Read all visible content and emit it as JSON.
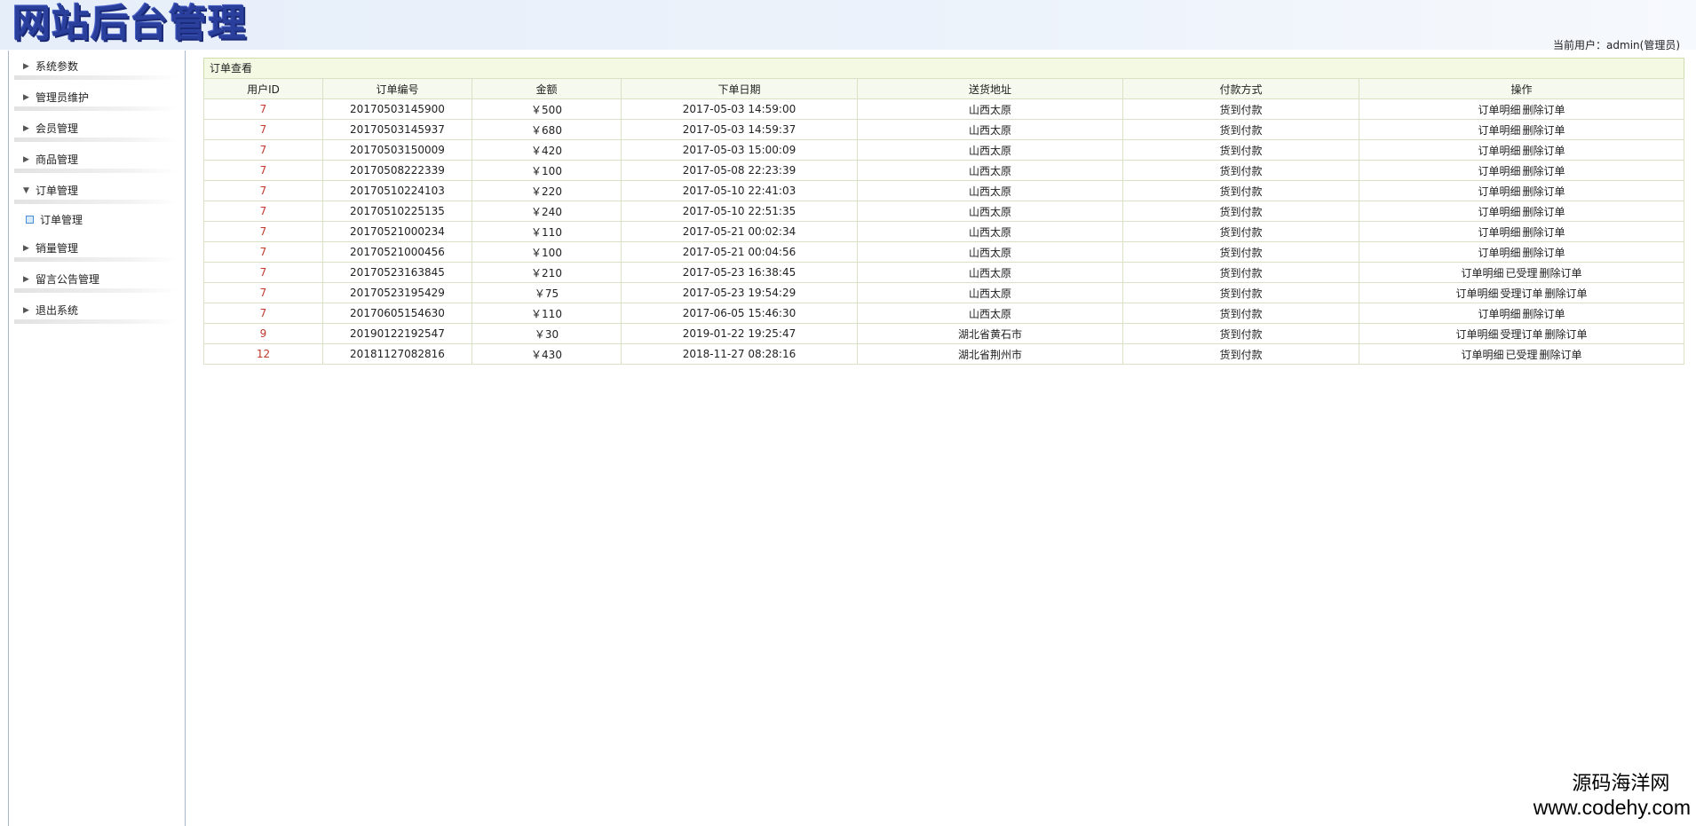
{
  "header": {
    "logo_text": "网站后台管理",
    "current_user": "当前用户：admin(管理员)"
  },
  "sidebar": {
    "items": [
      {
        "label": "系统参数",
        "expanded": false
      },
      {
        "label": "管理员维护",
        "expanded": false
      },
      {
        "label": "会员管理",
        "expanded": false
      },
      {
        "label": "商品管理",
        "expanded": false
      },
      {
        "label": "订单管理",
        "expanded": true,
        "children": [
          {
            "label": "订单管理"
          }
        ]
      },
      {
        "label": "销量管理",
        "expanded": false
      },
      {
        "label": "留言公告管理",
        "expanded": false
      },
      {
        "label": "退出系统",
        "expanded": false
      }
    ]
  },
  "panel": {
    "title": "订单查看",
    "columns": [
      "用户ID",
      "订单编号",
      "金额",
      "下单日期",
      "送货地址",
      "付款方式",
      "操作"
    ],
    "rows": [
      {
        "user_id": "7",
        "order_no": "20170503145900",
        "amount": "￥500",
        "date": "2017-05-03 14:59:00",
        "address": "山西太原",
        "payment": "货到付款",
        "ops": [
          "订单明细",
          "删除订单"
        ]
      },
      {
        "user_id": "7",
        "order_no": "20170503145937",
        "amount": "￥680",
        "date": "2017-05-03 14:59:37",
        "address": "山西太原",
        "payment": "货到付款",
        "ops": [
          "订单明细",
          "删除订单"
        ]
      },
      {
        "user_id": "7",
        "order_no": "20170503150009",
        "amount": "￥420",
        "date": "2017-05-03 15:00:09",
        "address": "山西太原",
        "payment": "货到付款",
        "ops": [
          "订单明细",
          "删除订单"
        ]
      },
      {
        "user_id": "7",
        "order_no": "20170508222339",
        "amount": "￥100",
        "date": "2017-05-08 22:23:39",
        "address": "山西太原",
        "payment": "货到付款",
        "ops": [
          "订单明细",
          "删除订单"
        ]
      },
      {
        "user_id": "7",
        "order_no": "20170510224103",
        "amount": "￥220",
        "date": "2017-05-10 22:41:03",
        "address": "山西太原",
        "payment": "货到付款",
        "ops": [
          "订单明细",
          "删除订单"
        ]
      },
      {
        "user_id": "7",
        "order_no": "20170510225135",
        "amount": "￥240",
        "date": "2017-05-10 22:51:35",
        "address": "山西太原",
        "payment": "货到付款",
        "ops": [
          "订单明细",
          "删除订单"
        ]
      },
      {
        "user_id": "7",
        "order_no": "20170521000234",
        "amount": "￥110",
        "date": "2017-05-21 00:02:34",
        "address": "山西太原",
        "payment": "货到付款",
        "ops": [
          "订单明细",
          "删除订单"
        ]
      },
      {
        "user_id": "7",
        "order_no": "20170521000456",
        "amount": "￥100",
        "date": "2017-05-21 00:04:56",
        "address": "山西太原",
        "payment": "货到付款",
        "ops": [
          "订单明细",
          "删除订单"
        ]
      },
      {
        "user_id": "7",
        "order_no": "20170523163845",
        "amount": "￥210",
        "date": "2017-05-23 16:38:45",
        "address": "山西太原",
        "payment": "货到付款",
        "ops": [
          "订单明细",
          "已受理",
          "删除订单"
        ]
      },
      {
        "user_id": "7",
        "order_no": "20170523195429",
        "amount": "￥75",
        "date": "2017-05-23 19:54:29",
        "address": "山西太原",
        "payment": "货到付款",
        "ops": [
          "订单明细",
          "受理订单",
          "删除订单"
        ]
      },
      {
        "user_id": "7",
        "order_no": "20170605154630",
        "amount": "￥110",
        "date": "2017-06-05 15:46:30",
        "address": "山西太原",
        "payment": "货到付款",
        "ops": [
          "订单明细",
          "删除订单"
        ]
      },
      {
        "user_id": "9",
        "order_no": "20190122192547",
        "amount": "￥30",
        "date": "2019-01-22 19:25:47",
        "address": "湖北省黄石市",
        "payment": "货到付款",
        "ops": [
          "订单明细",
          "受理订单",
          "删除订单"
        ]
      },
      {
        "user_id": "12",
        "order_no": "20181127082816",
        "amount": "￥430",
        "date": "2018-11-27 08:28:16",
        "address": "湖北省荆州市",
        "payment": "货到付款",
        "ops": [
          "订单明细",
          "已受理",
          "删除订单"
        ]
      }
    ]
  },
  "watermark": {
    "line1": "源码海洋网",
    "line2": "www.codehy.com"
  },
  "colors": {
    "logo": "#2a3f9c",
    "user_id": "#c0392b",
    "panel_title_bg": "#f4f9e4",
    "table_border": "#d9e2c4"
  }
}
